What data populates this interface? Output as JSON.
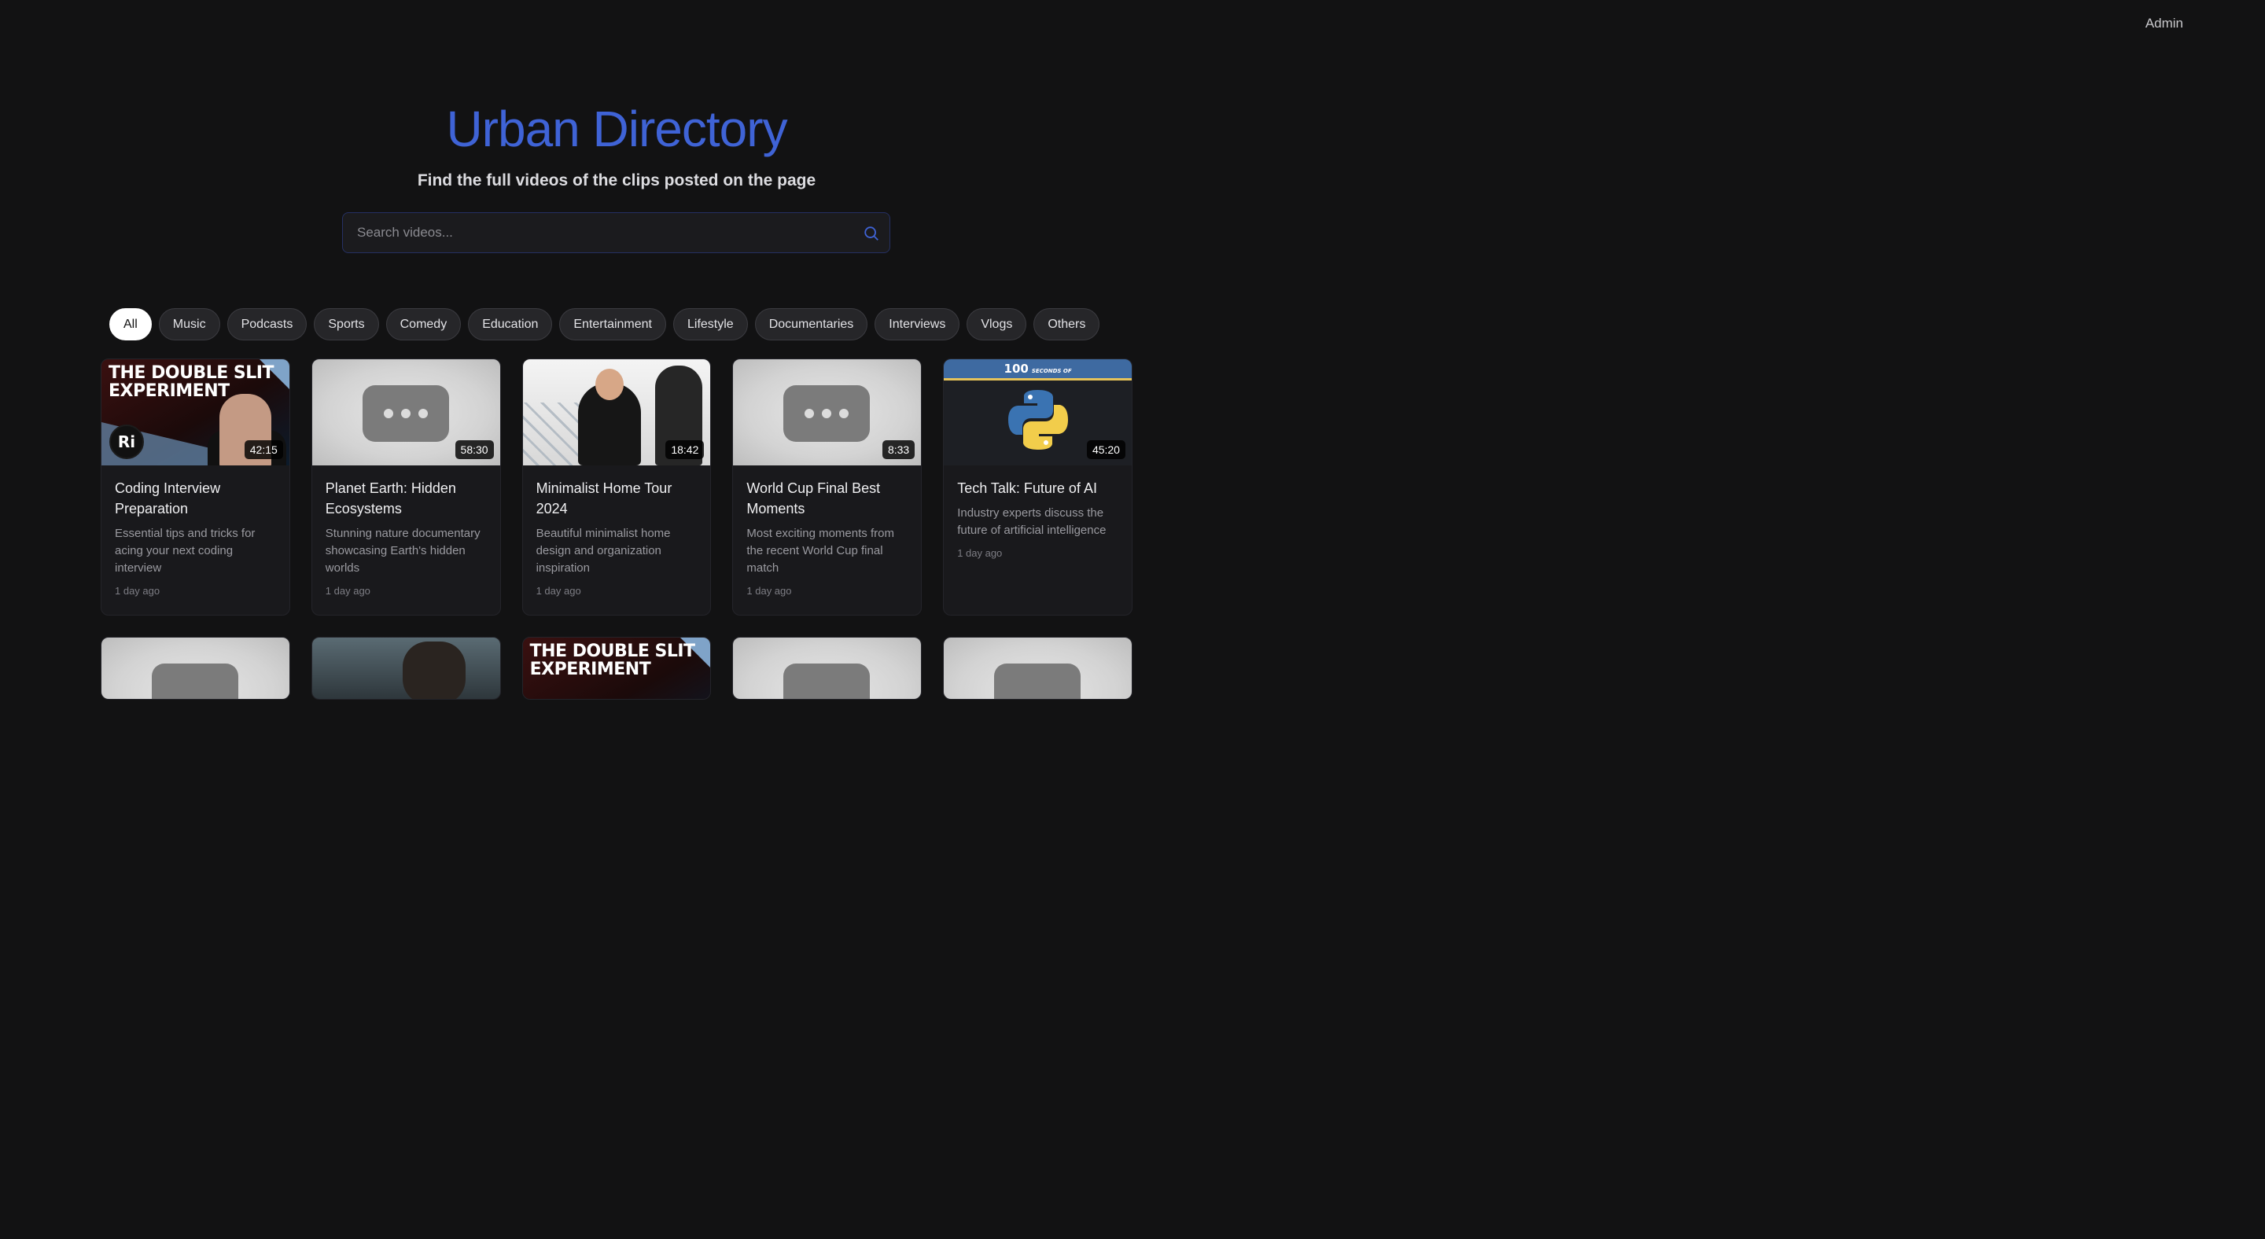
{
  "header": {
    "admin_label": "Admin"
  },
  "hero": {
    "title": "Urban Directory",
    "subtitle": "Find the full videos of the clips posted on the page"
  },
  "search": {
    "placeholder": "Search videos...",
    "value": ""
  },
  "filters": [
    "All",
    "Music",
    "Podcasts",
    "Sports",
    "Comedy",
    "Education",
    "Entertainment",
    "Lifestyle",
    "Documentaries",
    "Interviews",
    "Vlogs",
    "Others"
  ],
  "active_filter": "All",
  "colors": {
    "accent": "#3f63d6",
    "background": "#121213",
    "card": "#19191c"
  },
  "videos": [
    {
      "title": "Coding Interview Preparation",
      "description": "Essential tips and tricks for acing your next coding interview",
      "time": "1 day ago",
      "duration": "42:15",
      "thumb_text": "THE DOUBLE SLIT EXPERIMENT",
      "thumb_badge": "Ri"
    },
    {
      "title": "Planet Earth: Hidden Ecosystems",
      "description": "Stunning nature documentary showcasing Earth's hidden worlds",
      "time": "1 day ago",
      "duration": "58:30"
    },
    {
      "title": "Minimalist Home Tour 2024",
      "description": "Beautiful minimalist home design and organization inspiration",
      "time": "1 day ago",
      "duration": "18:42"
    },
    {
      "title": "World Cup Final Best Moments",
      "description": "Most exciting moments from the recent World Cup final match",
      "time": "1 day ago",
      "duration": "8:33"
    },
    {
      "title": "Tech Talk: Future of AI",
      "description": "Industry experts discuss the future of artificial intelligence",
      "time": "1 day ago",
      "duration": "45:20",
      "thumb_banner_number": "100",
      "thumb_banner_text": "SECONDS OF"
    }
  ],
  "row2_thumb_text": "THE DOUBLE SLIT EXPERIMENT"
}
